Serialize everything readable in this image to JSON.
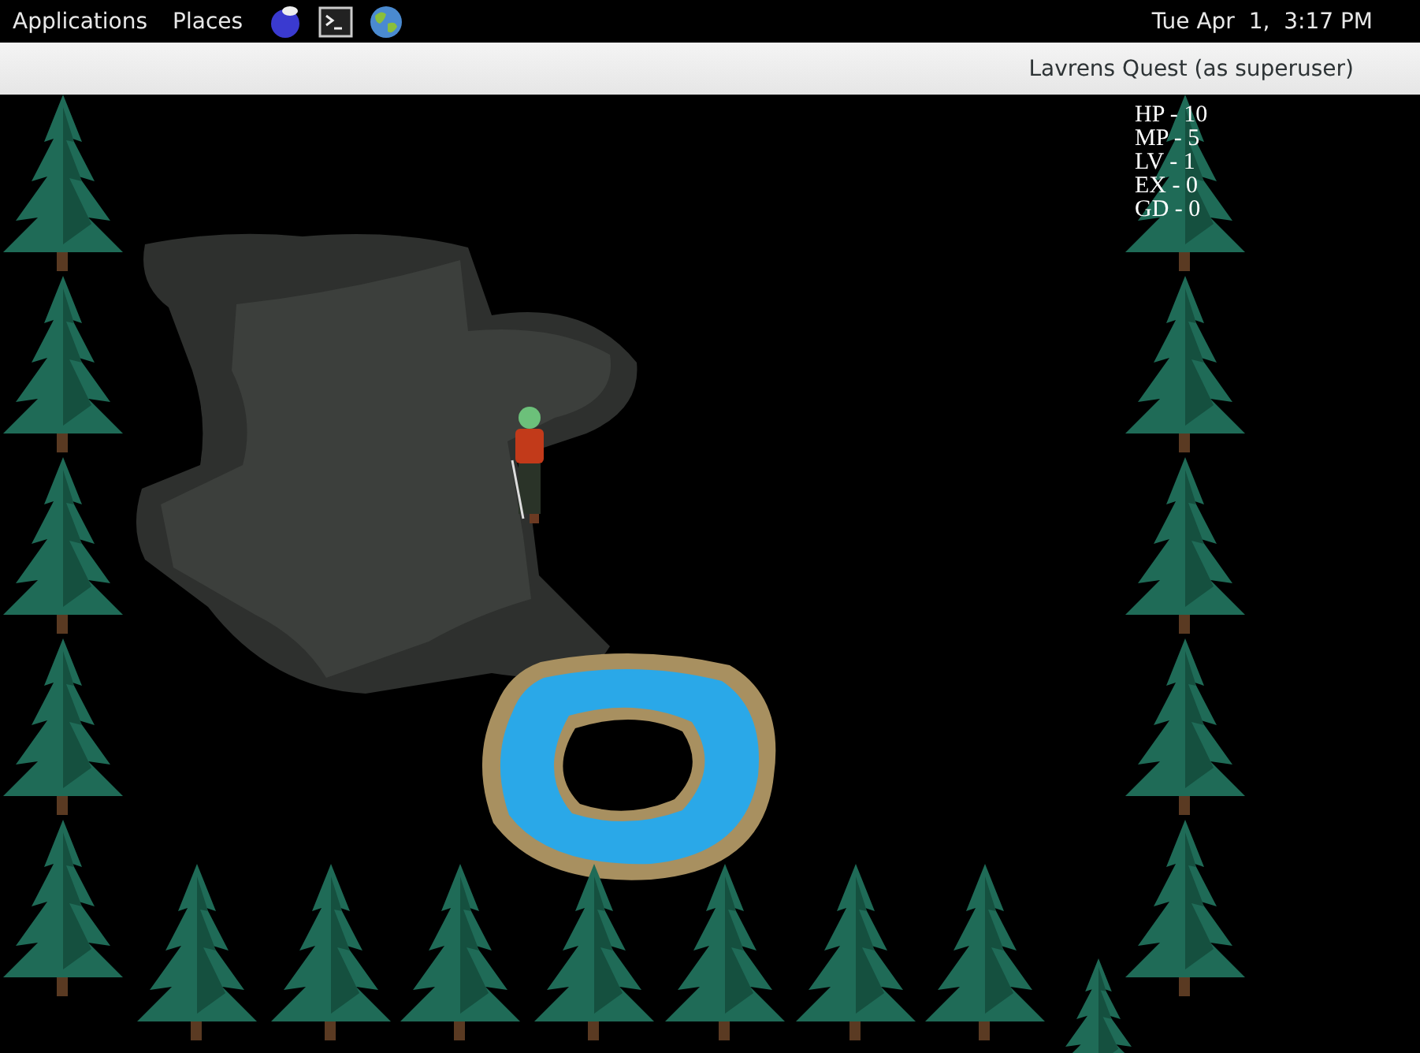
{
  "top_panel": {
    "menus": [
      {
        "label": "Applications"
      },
      {
        "label": "Places"
      }
    ],
    "clock": "Tue Apr  1,  3:17 PM"
  },
  "window": {
    "title": "Lavrens Quest (as superuser)"
  },
  "stats": [
    "HP - 10",
    "MP - 5",
    "LV - 1",
    "EX - 0",
    "GD - 0"
  ]
}
